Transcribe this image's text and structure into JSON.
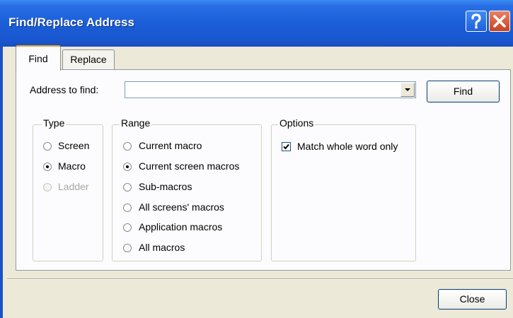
{
  "window": {
    "title": "Find/Replace Address"
  },
  "titlebar_buttons": {
    "help_icon": "help-icon",
    "close_icon": "close-icon"
  },
  "tabs": [
    {
      "label": "Find",
      "selected": true
    },
    {
      "label": "Replace",
      "selected": false
    }
  ],
  "address": {
    "label": "Address to find:",
    "value": "",
    "dropdown_icon": "chevron-down-icon"
  },
  "buttons": {
    "find": "Find",
    "close": "Close"
  },
  "type_group": {
    "title": "Type",
    "options": [
      {
        "label": "Screen",
        "checked": false,
        "enabled": true
      },
      {
        "label": "Macro",
        "checked": true,
        "enabled": true
      },
      {
        "label": "Ladder",
        "checked": false,
        "enabled": false
      }
    ]
  },
  "range_group": {
    "title": "Range",
    "options": [
      {
        "label": "Current macro",
        "checked": false
      },
      {
        "label": "Current screen macros",
        "checked": true
      },
      {
        "label": "Sub-macros",
        "checked": false
      },
      {
        "label": "All screens' macros",
        "checked": false
      },
      {
        "label": "Application macros",
        "checked": false
      },
      {
        "label": "All macros",
        "checked": false
      }
    ]
  },
  "options_group": {
    "title": "Options",
    "match_whole_word": {
      "label": "Match whole word only",
      "checked": true
    }
  },
  "colors": {
    "titlebar": "#1b5ed8",
    "dialog_bg": "#ece9d8",
    "panel_bg": "#fcfcfe",
    "close_button": "#c8431f"
  }
}
